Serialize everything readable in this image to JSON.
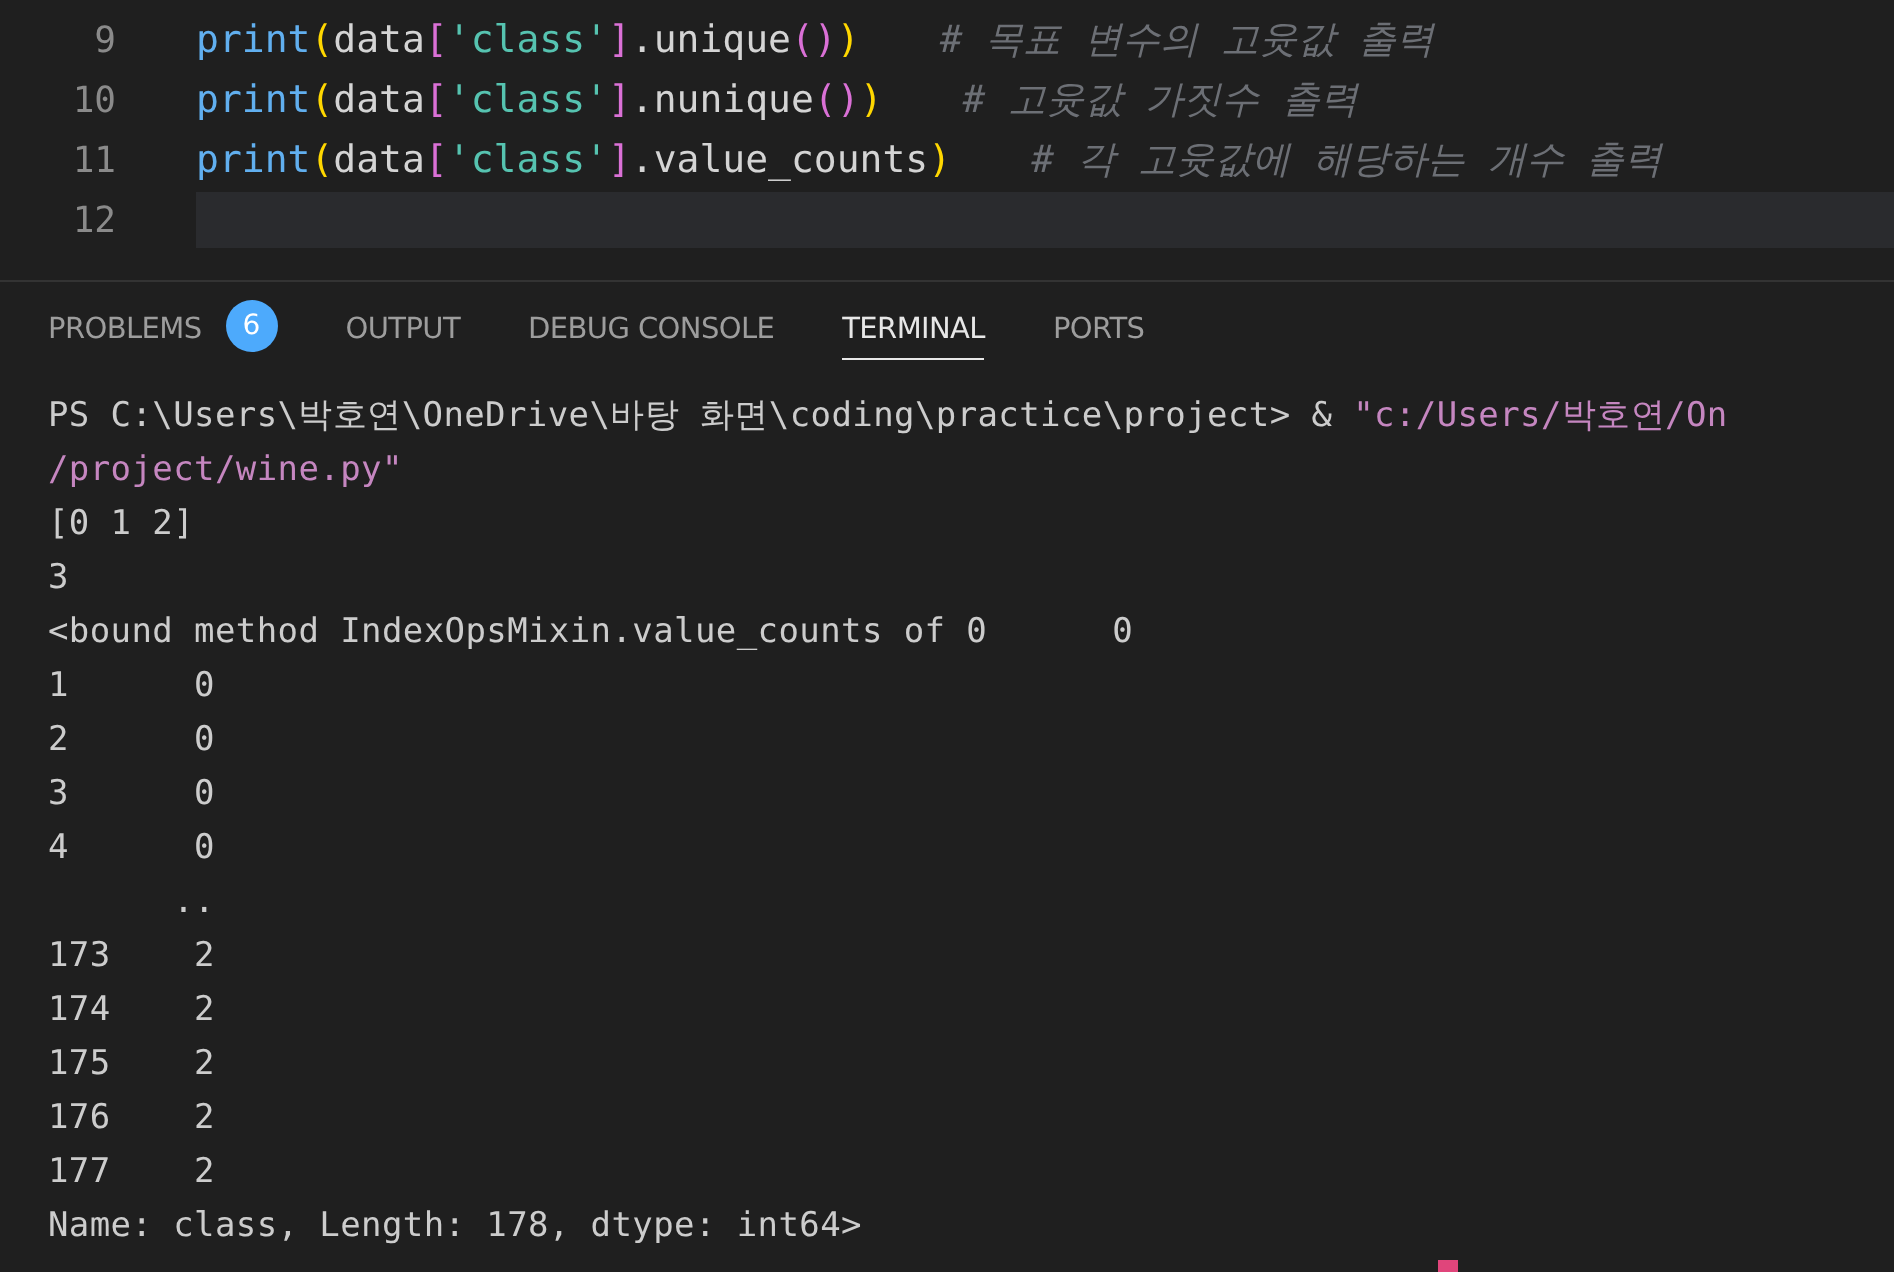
{
  "editor": {
    "lines": [
      {
        "number": "9",
        "current": false,
        "tokens": [
          {
            "kind": "func",
            "text": "print"
          },
          {
            "kind": "paren",
            "text": "("
          },
          {
            "kind": "plain",
            "text": "data"
          },
          {
            "kind": "bracket",
            "text": "["
          },
          {
            "kind": "string",
            "text": "'class'"
          },
          {
            "kind": "bracket",
            "text": "]"
          },
          {
            "kind": "plain",
            "text": ".unique"
          },
          {
            "kind": "paren2",
            "text": "()"
          },
          {
            "kind": "paren",
            "text": ")"
          },
          {
            "kind": "comment",
            "text": "# 목표 변수의 고윳값 출력"
          }
        ]
      },
      {
        "number": "10",
        "current": false,
        "tokens": [
          {
            "kind": "func",
            "text": "print"
          },
          {
            "kind": "paren",
            "text": "("
          },
          {
            "kind": "plain",
            "text": "data"
          },
          {
            "kind": "bracket",
            "text": "["
          },
          {
            "kind": "string",
            "text": "'class'"
          },
          {
            "kind": "bracket",
            "text": "]"
          },
          {
            "kind": "plain",
            "text": ".nunique"
          },
          {
            "kind": "paren2",
            "text": "()"
          },
          {
            "kind": "paren",
            "text": ")"
          },
          {
            "kind": "comment",
            "text": "# 고윳값 가짓수 출력"
          }
        ]
      },
      {
        "number": "11",
        "current": false,
        "tokens": [
          {
            "kind": "func",
            "text": "print"
          },
          {
            "kind": "paren",
            "text": "("
          },
          {
            "kind": "plain",
            "text": "data"
          },
          {
            "kind": "bracket",
            "text": "["
          },
          {
            "kind": "string",
            "text": "'class'"
          },
          {
            "kind": "bracket",
            "text": "]"
          },
          {
            "kind": "plain",
            "text": ".value_counts"
          },
          {
            "kind": "paren",
            "text": ")"
          },
          {
            "kind": "comment",
            "text": "# 각 고윳값에 해당하는 개수 출력"
          }
        ]
      },
      {
        "number": "12",
        "current": true
      }
    ]
  },
  "panel": {
    "tabs": [
      {
        "label": "PROBLEMS",
        "selected": false,
        "badge": "6"
      },
      {
        "label": "OUTPUT",
        "selected": false
      },
      {
        "label": "DEBUG CONSOLE",
        "selected": false
      },
      {
        "label": "TERMINAL",
        "selected": true
      },
      {
        "label": "PORTS",
        "selected": false
      }
    ],
    "terminal": [
      [
        {
          "kind": "plain",
          "text": "PS C:\\Users\\박호연\\OneDrive\\바탕 화면\\coding\\practice\\project> & "
        },
        {
          "kind": "string",
          "text": "\"c:/Users/박호연/On"
        }
      ],
      [
        {
          "kind": "string",
          "text": "/project/wine.py\""
        }
      ],
      [
        {
          "kind": "plain",
          "text": "[0 1 2]"
        }
      ],
      [
        {
          "kind": "plain",
          "text": "3"
        }
      ],
      [
        {
          "kind": "plain",
          "text": "<bound method IndexOpsMixin.value_counts of 0      0"
        }
      ],
      [
        {
          "kind": "plain",
          "text": "1      0"
        }
      ],
      [
        {
          "kind": "plain",
          "text": "2      0"
        }
      ],
      [
        {
          "kind": "plain",
          "text": "3      0"
        }
      ],
      [
        {
          "kind": "plain",
          "text": "4      0"
        }
      ],
      [
        {
          "kind": "plain",
          "text": "      .."
        }
      ],
      [
        {
          "kind": "plain",
          "text": "173    2"
        }
      ],
      [
        {
          "kind": "plain",
          "text": "174    2"
        }
      ],
      [
        {
          "kind": "plain",
          "text": "175    2"
        }
      ],
      [
        {
          "kind": "plain",
          "text": "176    2"
        }
      ],
      [
        {
          "kind": "plain",
          "text": "177    2"
        }
      ],
      [
        {
          "kind": "plain",
          "text": "Name: class, Length: 178, dtype: int64>"
        }
      ]
    ]
  }
}
